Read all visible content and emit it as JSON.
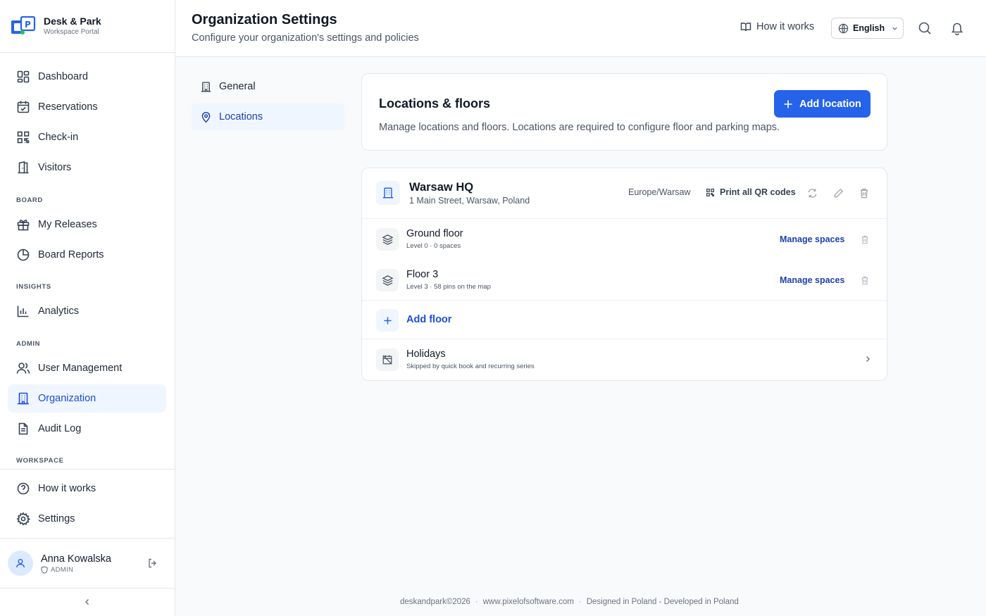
{
  "brand": {
    "name": "Desk & Park",
    "subtitle": "Workspace Portal"
  },
  "sidebar": {
    "items": [
      {
        "label": "Dashboard",
        "icon": "dashboard-icon"
      },
      {
        "label": "Reservations",
        "icon": "calendar-check-icon"
      },
      {
        "label": "Check-in",
        "icon": "qr-code-icon"
      },
      {
        "label": "Visitors",
        "icon": "door-icon"
      },
      {
        "label": "My Releases",
        "icon": "gift-icon"
      },
      {
        "label": "Board Reports",
        "icon": "pie-chart-icon"
      },
      {
        "label": "Analytics",
        "icon": "bar-chart-icon"
      },
      {
        "label": "User Management",
        "icon": "users-icon"
      },
      {
        "label": "Organization",
        "icon": "building-icon",
        "active": true
      },
      {
        "label": "Audit Log",
        "icon": "document-icon"
      },
      {
        "label": "How it works",
        "icon": "help-circle-icon"
      },
      {
        "label": "Settings",
        "icon": "gear-icon"
      }
    ],
    "sections": {
      "board": "BOARD",
      "insights": "INSIGHTS",
      "admin": "ADMIN",
      "workspace": "WORKSPACE"
    }
  },
  "user": {
    "name": "Anna Kowalska",
    "role": "ADMIN"
  },
  "header": {
    "title": "Organization Settings",
    "subtitle": "Configure your organization's settings and policies",
    "how_it_works": "How it works",
    "language": "English"
  },
  "subnav": [
    {
      "label": "General",
      "icon": "building-icon"
    },
    {
      "label": "Locations",
      "icon": "map-pin-icon",
      "active": true
    }
  ],
  "locations_card": {
    "title": "Locations & floors",
    "description": "Manage locations and floors. Locations are required to configure floor and parking maps.",
    "add_button": "Add location"
  },
  "location": {
    "name": "Warsaw HQ",
    "address": "1 Main Street, Warsaw, Poland",
    "timezone": "Europe/Warsaw",
    "print_qr": "Print all QR codes",
    "floors": [
      {
        "name": "Ground floor",
        "meta": "Level 0 · 0 spaces",
        "action": "Manage spaces"
      },
      {
        "name": "Floor 3",
        "meta": "Level 3 · 58 pins on the map",
        "action": "Manage spaces"
      }
    ],
    "add_floor": "Add floor",
    "holidays": {
      "title": "Holidays",
      "subtitle": "Skipped by quick book and recurring series"
    }
  },
  "footer": {
    "copyright": "deskandpark©2026",
    "sep1": "·",
    "website": "www.pixelofsoftware.com",
    "sep2": "·",
    "tagline": "Designed in Poland - Developed in Poland"
  },
  "colors": {
    "accent": "#2563eb",
    "active_bg": "#eff6ff",
    "active_text": "#1d4ed8"
  }
}
